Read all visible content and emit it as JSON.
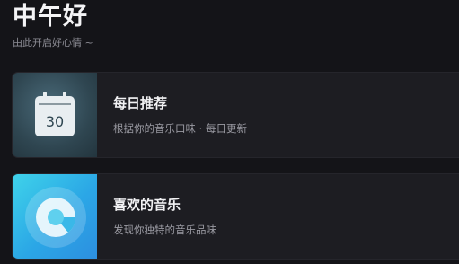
{
  "header": {
    "greeting": "中午好",
    "subtitle": "由此开启好心情 ~"
  },
  "cards": [
    {
      "title": "每日推荐",
      "description": "根据你的音乐口味 · 每日更新",
      "icon": "calendar-icon",
      "calendar_day": "30"
    },
    {
      "title": "喜欢的音乐",
      "description": "发现你独特的音乐品味",
      "icon": "music-disc-icon"
    }
  ],
  "colors": {
    "background": "#141418",
    "card_background": "#1d1d22",
    "calendar_tile": "#2f4651",
    "music_tile_start": "#3fd3ea",
    "music_tile_end": "#2d8fe0"
  }
}
